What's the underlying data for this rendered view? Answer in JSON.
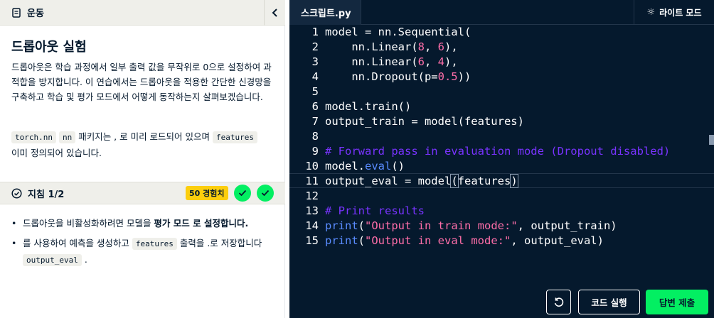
{
  "course": {
    "title": "운동",
    "collapse_icon": "chevron-left-icon"
  },
  "exercise": {
    "title": "드롭아웃 실험",
    "desc": "드롭아웃은 학습 과정에서 일부 출력 값을 무작위로 0으로 설정하여 과적합을 방지합니다. 이 연습에서는 드롭아웃을 적용한 간단한 신경망을 구축하고 학습 및 평가 모드에서 어떻게 동작하는지 살펴보겠습니다.",
    "p2_code1": "torch.nn",
    "p2_code2": "nn",
    "p2_text1": " 패키지는 , 로 미리 로드되어 있으며 ",
    "p2_code3": "features",
    "p2_text2": "이미 정의되어 있습니다."
  },
  "instructions": {
    "title": "지침 1/2",
    "xp": "50 경험치",
    "items": [
      {
        "text_before": "드롭아웃을 비활성화하려면 모델을 ",
        "bold": "평가 모드 로 설정합니다."
      },
      {
        "text1": "를 사용하여 예측을 생성하고 ",
        "code1": "features",
        "text2": " 출력을 .로 저장합니다",
        "code2": "output_eval",
        "text3": " ."
      }
    ]
  },
  "editor": {
    "tab": "스크립트.py",
    "light_mode": "라이트 모드",
    "line_numbers": [
      "1",
      "2",
      "3",
      "4",
      "5",
      "6",
      "7",
      "8",
      "9",
      "10",
      "11",
      "12",
      "13",
      "14",
      "15"
    ]
  },
  "buttons": {
    "run": "코드 실행",
    "submit": "답변 제출"
  },
  "colors": {
    "accent": "#03ef62",
    "xp": "#fcce0d",
    "editor_bg": "#05192d"
  }
}
